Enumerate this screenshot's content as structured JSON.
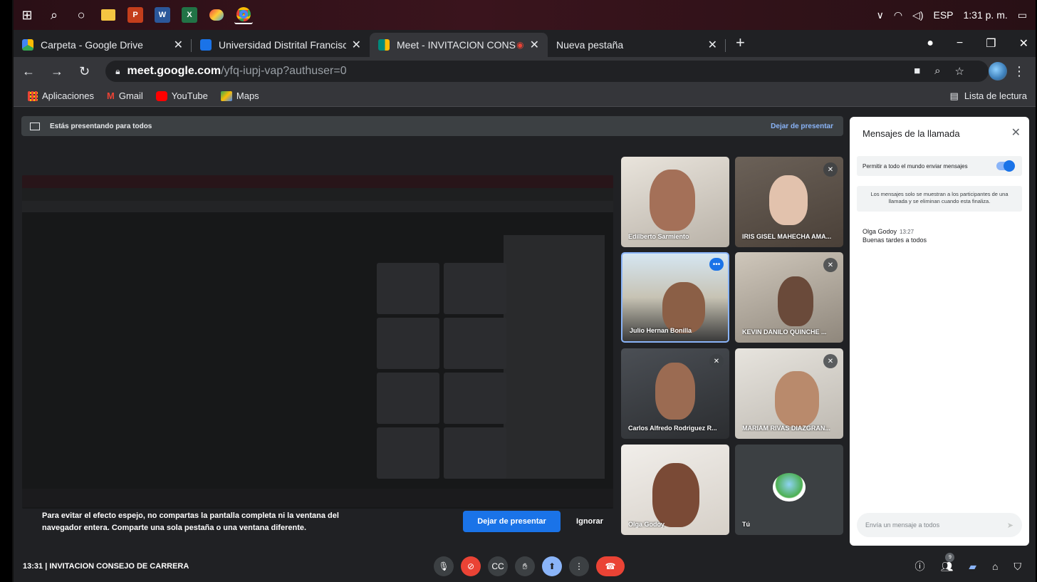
{
  "taskbar": {
    "lang": "ESP",
    "clock": "1:31 p. m.",
    "apps": [
      "P",
      "W",
      "X"
    ]
  },
  "tabs": [
    {
      "title": "Carpeta - Google Drive",
      "color": "#34a853"
    },
    {
      "title": "Universidad Distrital Francisco Jo",
      "color": "#1a73e8"
    },
    {
      "title": "Meet - INVITACION CONSEJ",
      "color": "#00897b"
    },
    {
      "title": "Nueva pestaña",
      "color": ""
    }
  ],
  "address": {
    "domain": "meet.google.com",
    "path": "/yfq-iupj-vap?authuser=0"
  },
  "bookmarks": [
    "Aplicaciones",
    "Gmail",
    "YouTube",
    "Maps"
  ],
  "reading_list": "Lista de lectura",
  "presenting": {
    "text": "Estás presentando para todos",
    "stop": "Dejar de presentar"
  },
  "participants": [
    {
      "name": "Edilberto Sarmiento"
    },
    {
      "name": "IRIS GISEL MAHECHA AMA..."
    },
    {
      "name": "Julio Hernan Bonilla"
    },
    {
      "name": "KEVIN DANILO QUINCHE ..."
    },
    {
      "name": "Carlos Alfredo Rodriguez R..."
    },
    {
      "name": "MARIAM RIVAS DIAZGRAN..."
    },
    {
      "name": "Olga Godoy"
    },
    {
      "name": "Tú"
    }
  ],
  "warning": {
    "text": "Para evitar el efecto espejo, no compartas la pantalla completa ni la ventana del navegador entera. Comparte una sola pestaña o una ventana diferente.",
    "stop_button": "Dejar de presentar",
    "ignore_button": "Ignorar"
  },
  "chat": {
    "title": "Mensajes de la llamada",
    "permission": "Permitir a todo el mundo enviar mensajes",
    "note": "Los mensajes solo se muestran a los participantes de una llamada y se eliminan cuando esta finaliza.",
    "author": "Olga Godoy",
    "time": "13:27",
    "message": "Buenas tardes a todos",
    "input_placeholder": "Envía un mensaje a todos"
  },
  "meeting": {
    "info": "13:31 | INVITACION CONSEJO DE CARRERA",
    "people_count": "9"
  },
  "colors": {
    "accent": "#1a73e8",
    "danger": "#ea4335"
  }
}
